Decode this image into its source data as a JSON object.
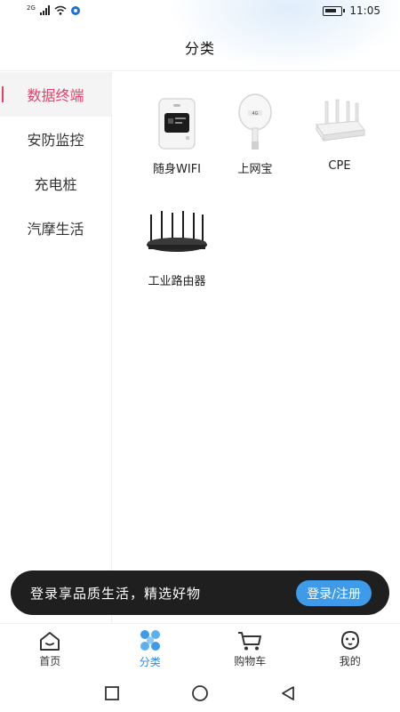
{
  "status_bar": {
    "network": "2G",
    "time": "11:05"
  },
  "header": {
    "title": "分类"
  },
  "sidebar": {
    "items": [
      {
        "label": "数据终端",
        "active": true
      },
      {
        "label": "安防监控",
        "active": false
      },
      {
        "label": "充电桩",
        "active": false
      },
      {
        "label": "汽摩生活",
        "active": false
      }
    ]
  },
  "products": [
    {
      "name": "随身WIFI",
      "icon": "pocket-wifi-icon"
    },
    {
      "name": "上网宝",
      "icon": "usb-modem-icon"
    },
    {
      "name": "CPE",
      "icon": "cpe-router-icon"
    },
    {
      "name": "工业路由器",
      "icon": "industrial-router-icon"
    }
  ],
  "login_banner": {
    "text": "登录享品质生活，精选好物",
    "button_label": "登录/注册"
  },
  "bottom_nav": {
    "items": [
      {
        "label": "首页",
        "icon": "home-icon",
        "active": false
      },
      {
        "label": "分类",
        "icon": "category-icon",
        "active": true
      },
      {
        "label": "购物车",
        "icon": "cart-icon",
        "active": false
      },
      {
        "label": "我的",
        "icon": "profile-icon",
        "active": false
      }
    ]
  },
  "colors": {
    "accent": "#e83e6b",
    "primary": "#3d9bea",
    "banner_bg": "#1f1f1f"
  }
}
